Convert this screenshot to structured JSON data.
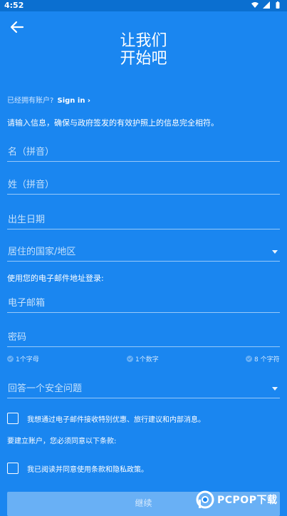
{
  "status_bar": {
    "time": "4:52"
  },
  "header": {
    "title_line1": "让我们",
    "title_line2": "开始吧"
  },
  "signin": {
    "prompt": "已经拥有账户?",
    "link": "Sign in ›"
  },
  "note": "请输入信息，确保与政府签发的有效护照上的信息完全相符。",
  "fields": {
    "given_name": "名（拼音）",
    "surname": "姓（拼音）",
    "birth_date": "出生日期",
    "country": "居住的国家/地区",
    "email_label": "使用您的电子邮件地址登录:",
    "email": "电子邮箱",
    "password": "密码",
    "security_question": "回答一个安全问题"
  },
  "password_requirements": [
    "1个字母",
    "1个数字",
    "8 个字符"
  ],
  "opt_in": "我想通过电子邮件接收特别优惠、旅行建议和内部消息。",
  "terms_heading": "要建立账户，您必须同意以下条款:",
  "terms": {
    "prefix": "我已阅读并同意",
    "terms_link": "使用条款",
    "and": "和",
    "privacy_link": "隐私政策",
    "suffix": "。"
  },
  "continue_label": "继续",
  "watermark": {
    "text": "PCPOP下载"
  },
  "colors": {
    "background": "#1a86f0",
    "status_bar": "#0b6fd0"
  }
}
